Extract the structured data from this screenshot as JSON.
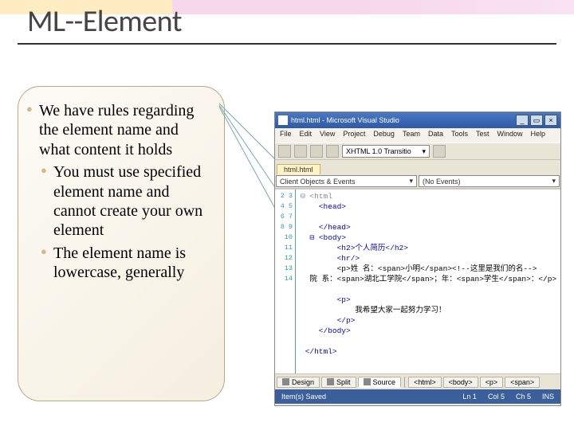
{
  "slide": {
    "title": "ML--Element",
    "main_bullet": "We have rules regarding the element name and what content it holds",
    "sub_bullets": [
      "You must use specified element name and cannot create your own element",
      "The element name is lowercase, generally"
    ]
  },
  "ide": {
    "app_title": "html.html - Microsoft Visual Studio",
    "menu": [
      "File",
      "Edit",
      "View",
      "Project",
      "Debug",
      "Team",
      "Data",
      "Tools",
      "Test",
      "Window",
      "Help"
    ],
    "toolbar_doctype": "XHTML 1.0 Transitio",
    "file_tab": "html.html",
    "dropdown_left": "Client Objects & Events",
    "dropdown_right": "(No Events)",
    "gutter_lines": [
      "2",
      "3",
      "4",
      "5",
      "6",
      "7",
      "8",
      "9",
      "10",
      "11",
      "12",
      "13",
      "14"
    ],
    "code_lines": [
      {
        "cls": "t-gray",
        "text": "⊟ <html"
      },
      {
        "cls": "t-blue",
        "text": "    <head>"
      },
      {
        "cls": "",
        "text": ""
      },
      {
        "cls": "t-blue",
        "text": "    </head>"
      },
      {
        "cls": "t-blue",
        "text": "  ⊟ <body>"
      },
      {
        "cls": "t-blue",
        "text": "        <h2>个人简历</h2>"
      },
      {
        "cls": "t-blue",
        "text": "        <hr/>"
      },
      {
        "cls": "",
        "text": "        <p>姓 名：<span>小明</span><!--这里是我们的名-->"
      },
      {
        "cls": "",
        "text": "  院 系：<span>湖北工学院</span>；年：<span>学生</span>：</p>"
      },
      {
        "cls": "",
        "text": ""
      },
      {
        "cls": "t-blue",
        "text": "        <p>"
      },
      {
        "cls": "",
        "text": "            我希望大家一起努力学习！"
      },
      {
        "cls": "t-blue",
        "text": "        </p>"
      },
      {
        "cls": "t-blue",
        "text": "    </body>"
      },
      {
        "cls": "",
        "text": ""
      },
      {
        "cls": "t-blue",
        "text": " </html>"
      }
    ],
    "bottom_tabs": [
      {
        "label": "Design",
        "active": false
      },
      {
        "label": "Split",
        "active": false
      },
      {
        "label": "Source",
        "active": true
      }
    ],
    "breadcrumb": [
      "<html>",
      "<body>",
      "<p>",
      "<span>"
    ],
    "status_left": "Item(s) Saved",
    "status_ln": "Ln 1",
    "status_col": "Col 5",
    "status_ch": "Ch 5",
    "status_ins": "INS"
  }
}
